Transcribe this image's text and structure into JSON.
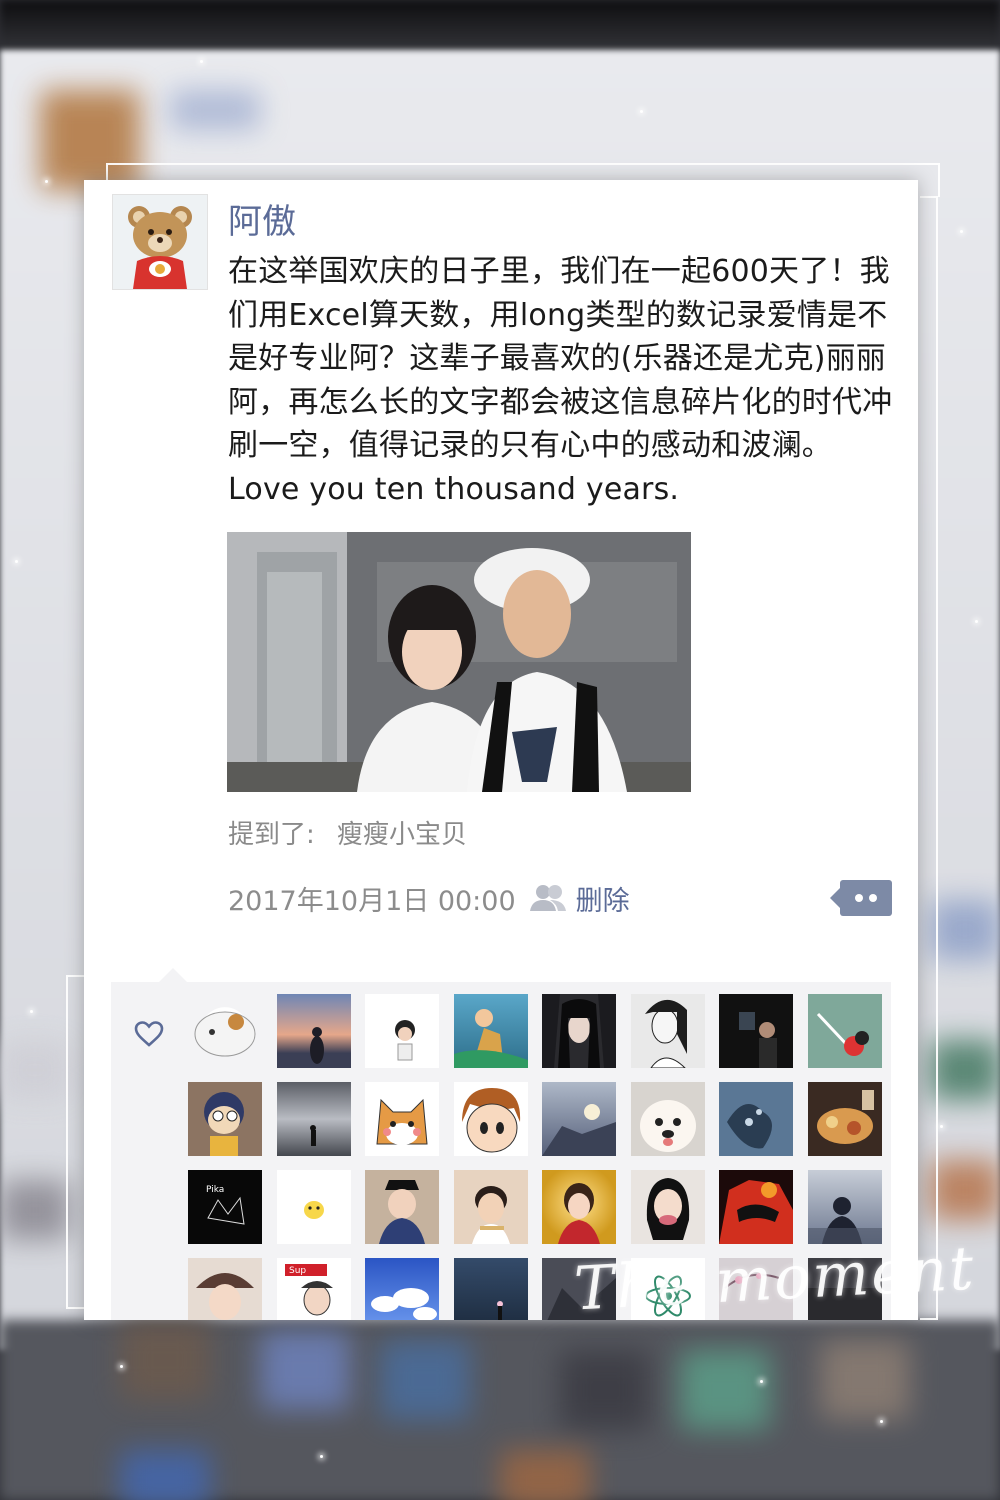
{
  "post": {
    "author": "阿傲",
    "text": "在这举国欢庆的日子里，我们在一起600天了！我们用Excel算天数，用long类型的数记录爱情是不是好专业阿？这辈子最喜欢的(乐器还是尤克)丽丽阿，再怎么长的文字都会被这信息碎片化的时代冲刷一空，值得记录的只有心中的感动和波澜。Love you ten thousand years.",
    "mention_label": "提到了:",
    "mention_name": "瘦瘦小宝贝",
    "timestamp": "2017年10月1日 00:00",
    "delete_label": "删除"
  },
  "icons": {
    "avatar": "teddy-bear-avatar",
    "visibility": "people-icon",
    "comment": "comment-dots-icon",
    "like": "heart-icon"
  },
  "likes": {
    "count_shown": 32
  },
  "overlay_text": "The moment",
  "colors": {
    "name_link": "#5b6b97",
    "comment_button": "#7d8aa6",
    "likes_bg": "#f3f3f5"
  }
}
